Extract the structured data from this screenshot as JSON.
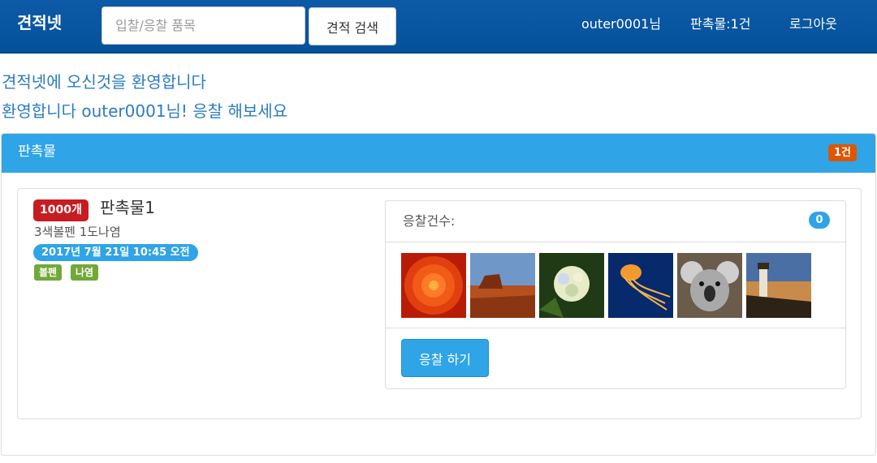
{
  "nav": {
    "brand": "견적넷",
    "search_placeholder": "입찰/응찰 품목",
    "search_button": "견적 검색",
    "user": "outer0001님",
    "items_link": "판촉물:1건",
    "logout": "로그아웃"
  },
  "welcome": {
    "line1": "견적넷에 오신것을 환영합니다",
    "line2": "환영합니다 outer0001님! 응찰 해보세요"
  },
  "panel": {
    "title": "판촉물",
    "count_badge": "1건"
  },
  "item": {
    "quantity": "1000개",
    "name": "판촉물1",
    "description": "3색볼펜 1도나염",
    "date": "2017년 7월 21일 10:45 오전",
    "tags": [
      "볼펜",
      "나염"
    ]
  },
  "bid": {
    "label": "응찰건수:",
    "count": "0",
    "thumbnails": [
      "flower-image",
      "desert-image",
      "hydrangea-image",
      "jellyfish-image",
      "koala-image",
      "lighthouse-image"
    ],
    "button": "응찰 하기"
  },
  "colors": {
    "navbar": "#04519b",
    "primary": "#2fa4e7",
    "danger": "#c71c22",
    "warning": "#dd5600",
    "success": "#73a839",
    "welcome_text": "#2a7cc2"
  }
}
